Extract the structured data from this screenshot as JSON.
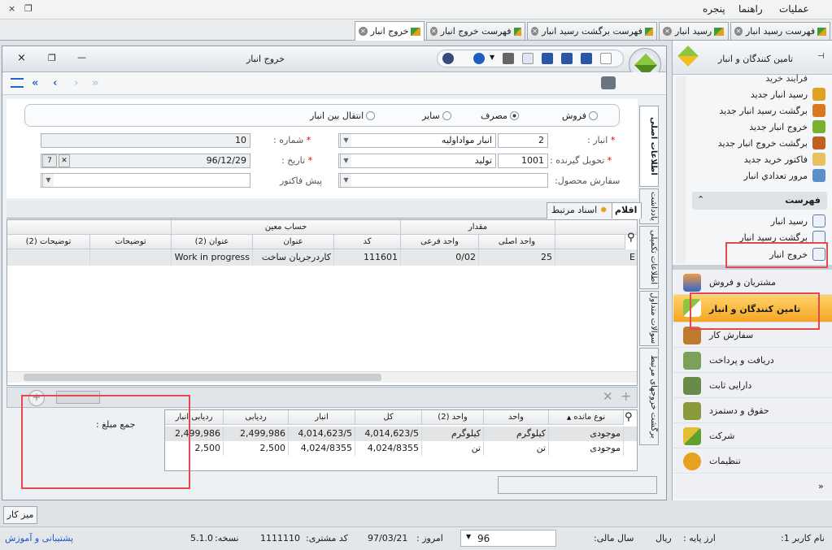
{
  "menubar": {
    "items": [
      "عملیات",
      "راهنما",
      "پنجره"
    ],
    "window_controls": [
      "×",
      "❐"
    ]
  },
  "tabs": [
    {
      "label": "فهرست رسید انبار"
    },
    {
      "label": "رسید انبار"
    },
    {
      "label": "فهرست برگشت رسید انبار"
    },
    {
      "label": "فهرست خروج انبار"
    },
    {
      "label": "خروج انبار"
    }
  ],
  "window": {
    "title": "خروج انبار",
    "controls": [
      "×",
      "❐",
      "—"
    ]
  },
  "form": {
    "radios": [
      {
        "label": "فروش",
        "checked": false
      },
      {
        "label": "مصرف",
        "checked": true
      },
      {
        "label": "سایر",
        "checked": false
      },
      {
        "label": "انتقال بین انبار",
        "checked": false
      }
    ],
    "warehouse_label": "انبار :",
    "warehouse_code": "2",
    "warehouse_name": "انبار مواداولیه",
    "receiver_label": "تحویل گیرنده :",
    "receiver_code": "1001",
    "receiver_name": "تولید",
    "product_order_label": "سفارش محصول:",
    "number_label": "شماره :",
    "number_value": "10",
    "date_label": "تاریخ :",
    "date_value": "96/12/29",
    "preinvoice_label": "پیش فاکتور",
    "required_mark": "*"
  },
  "side_tabs": [
    "اطلاعات اصلی",
    "یادداشت",
    "اطلاعات تکمیلی",
    "سوالات متداول",
    "برگشت خروجهای مرتبط"
  ],
  "grid_tabs": [
    "اقلام",
    "اسناد مرتبط"
  ],
  "grid": {
    "group_headers": {
      "account": "حساب معین",
      "quantity": "مقدار"
    },
    "columns": [
      "توضیحات (2)",
      "توضیحات",
      "عنوان (2)",
      "عنوان",
      "کد",
      "واحد فرعی",
      "واحد اصلی"
    ],
    "row": {
      "desc2": "",
      "desc": "",
      "title2": "Work in progress",
      "title": "کاردرجریان ساخت",
      "code": "111601",
      "sub_unit": "0/02",
      "main_unit": "25",
      "extra": "E"
    }
  },
  "summary": {
    "total_label": "جمع مبلغ :",
    "columns": [
      "ردیابی انبار",
      "ردیابی",
      "انبار",
      "کل",
      "واحد (2)",
      "واحد",
      "نوع مانده"
    ],
    "rows": [
      [
        "2,499,986",
        "2,499,986",
        "4,014,623/5",
        "4,014,623/5",
        "کیلوگرم",
        "کیلوگرم",
        "موجودی"
      ],
      [
        "2,500",
        "2,500",
        "4,024/8355",
        "4,024/8355",
        "تن",
        "تن",
        "موجودی"
      ]
    ]
  },
  "right_panel": {
    "header": "تامین کنندگان و انبار",
    "pin": "⊣",
    "top_items": [
      "فرایند خرید",
      "رسید انبار جدید",
      "برگشت رسید انبار جدید",
      "خروج انبار جدید",
      "برگشت خروج انبار جدید",
      "فاکتور خرید جدید",
      "مرور تعدادي انبار"
    ],
    "list_header": "فهرست",
    "list_items": [
      "رسید انبار",
      "برگشت رسید انبار",
      "خروج انبار"
    ],
    "modules": [
      "مشتریان و فروش",
      "تامین کنندگان و انبار",
      "سفارش کار",
      "دریافت و پرداخت",
      "دارایی ثابت",
      "حقوق و دستمزد",
      "شرکت",
      "تنظیمات"
    ]
  },
  "desk_button": "میز کار",
  "status": {
    "user_label": "نام کاربر 1:",
    "base_currency_label": "ارز پایه :",
    "base_currency": "ریال",
    "fiscal_year_label": "سال مالی:",
    "fiscal_year": "96",
    "today_label": "امروز :",
    "today": "97/03/21",
    "customer_code_label": "کد مشتری:",
    "customer_code": "1111110",
    "version_label": "نسخه:",
    "version": "5.1.0",
    "support_link": "پشتیبانی و آموزش"
  },
  "colors": {
    "accent": "#f5a623",
    "highlight": "#e5484d",
    "link": "#1a56c4"
  }
}
